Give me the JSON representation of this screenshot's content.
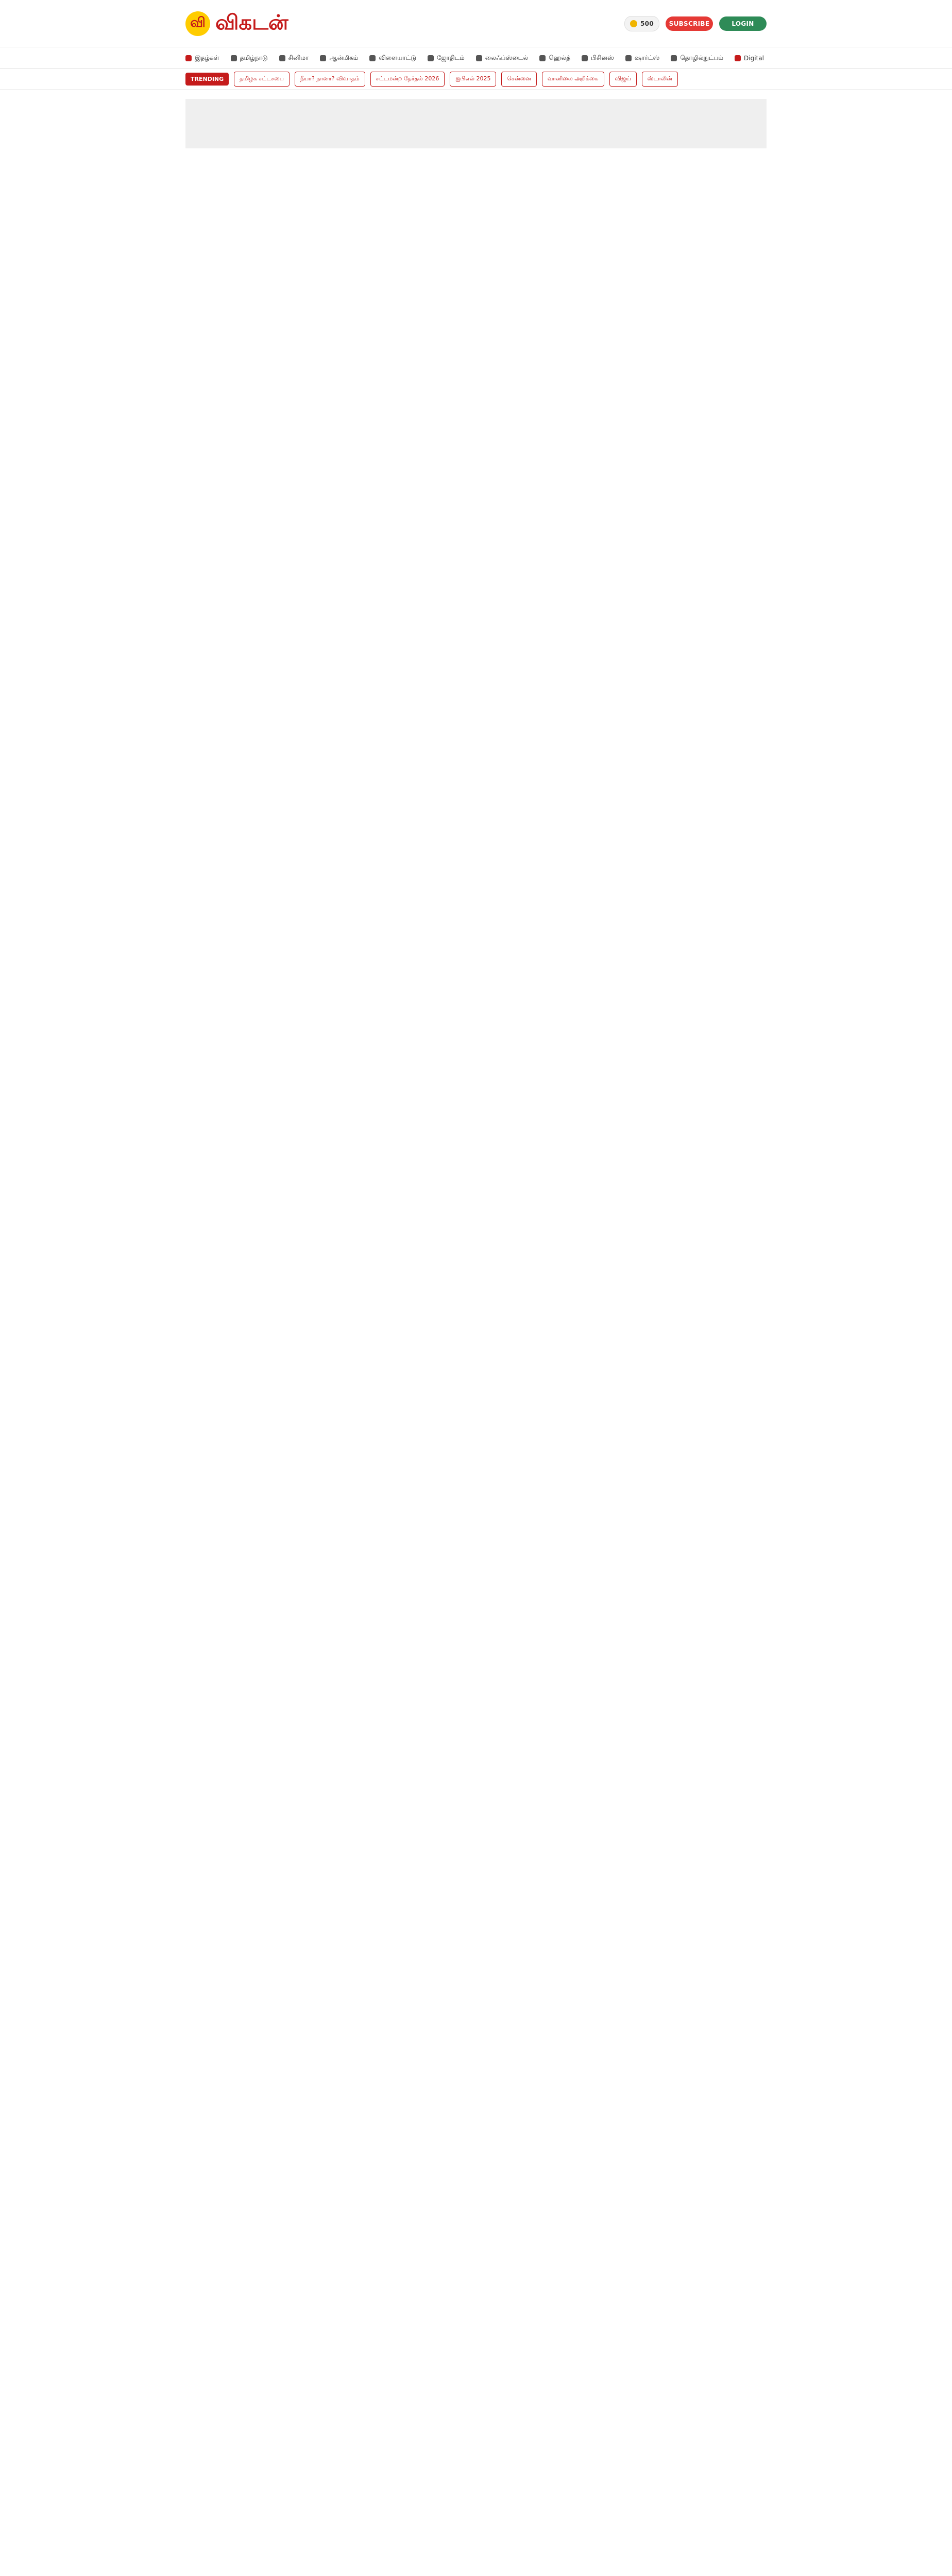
{
  "brand": {
    "logo_mark": "வி",
    "logo_text": "விகடன்"
  },
  "top": {
    "coin_text": "500",
    "subscribe": "SUBSCRIBE",
    "login": "LOGIN"
  },
  "nav": [
    {
      "label": "இதழ்கள்"
    },
    {
      "label": "தமிழ்நாடு"
    },
    {
      "label": "சினிமா"
    },
    {
      "label": "ஆன்மிகம்"
    },
    {
      "label": "விளையாட்டு"
    },
    {
      "label": "ஜோதிடம்"
    },
    {
      "label": "லைஃப்ஸ்டைல்"
    },
    {
      "label": "ஹெல்த்"
    },
    {
      "label": "பிசினஸ்"
    },
    {
      "label": "ஷார்ட்ஸ்"
    },
    {
      "label": "தொழில்நுட்பம்"
    },
    {
      "label": "Digital"
    }
  ],
  "trending": {
    "label": "TRENDING",
    "chips": [
      "தமிழக சட்டசபை",
      "நீயா? நானா? விவாதம்",
      "சட்டமன்ற தேர்தல் 2026",
      "ஐபிஎல் 2025",
      "சென்னை",
      "வானிலை அறிக்கை",
      "விஜய்",
      "ஸ்டாலின்"
    ]
  }
}
